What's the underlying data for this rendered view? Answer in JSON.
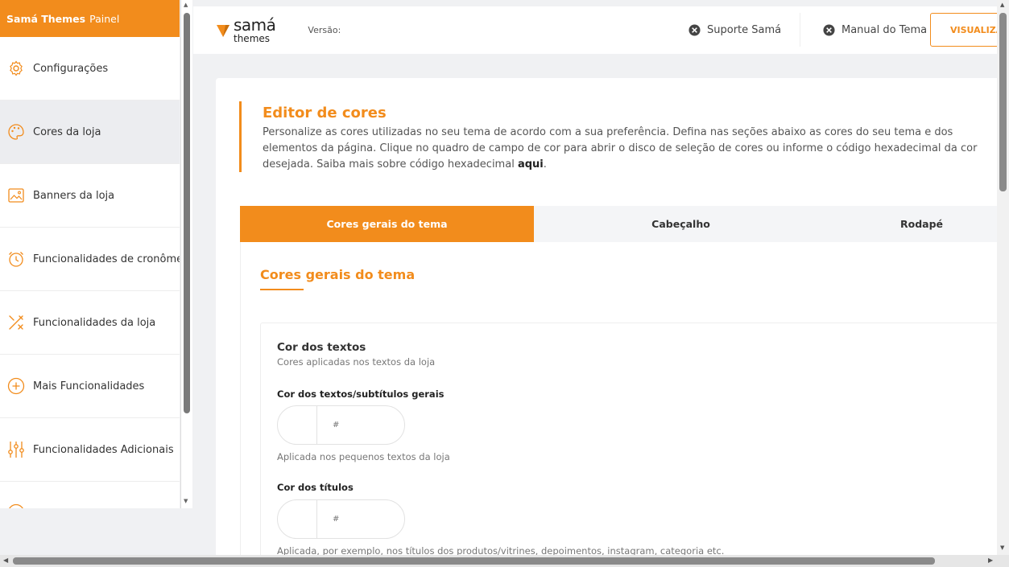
{
  "sidebar": {
    "brand_bold": "Samá Themes",
    "brand_light": "Painel",
    "items": [
      {
        "label": "Configurações"
      },
      {
        "label": "Cores da loja"
      },
      {
        "label": "Banners da loja"
      },
      {
        "label": "Funcionalidades de cronômetro"
      },
      {
        "label": "Funcionalidades da loja"
      },
      {
        "label": "Mais Funcionalidades"
      },
      {
        "label": "Funcionalidades Adicionais"
      }
    ]
  },
  "header": {
    "logo_line1": "samá",
    "logo_line2": "themes",
    "version_label": "Versão:",
    "support_link": "Suporte Samá",
    "manual_link": "Manual do Tema",
    "view_button": "VISUALIZAR"
  },
  "intro": {
    "title": "Editor de cores",
    "text": "Personalize as cores utilizadas no seu tema de acordo com a sua preferência. Defina nas seções abaixo as cores do seu tema e dos elementos da página. Clique no quadro de campo de cor para abrir o disco de seleção de cores ou informe o código hexadecimal da cor desejada. Saiba mais sobre código hexadecimal ",
    "link": "aqui",
    "text_end": "."
  },
  "tabs": [
    {
      "label": "Cores gerais do tema"
    },
    {
      "label": "Cabeçalho"
    },
    {
      "label": "Rodapé"
    }
  ],
  "panel": {
    "title": "Cores gerais do tema",
    "section": {
      "title": "Cor dos textos",
      "subtitle": "Cores aplicadas nos textos da loja",
      "fields": [
        {
          "label": "Cor dos textos/subtítulos gerais",
          "placeholder": "#",
          "help": "Aplicada nos pequenos textos da loja"
        },
        {
          "label": "Cor dos títulos",
          "placeholder": "#",
          "help": "Aplicada, por exemplo, nos títulos dos produtos/vitrines, depoimentos, instagram, categoria etc."
        }
      ]
    }
  },
  "colors": {
    "accent": "#f28c1c",
    "active_nav_bg": "#ecedf0",
    "page_bg": "#f0f1f3"
  }
}
